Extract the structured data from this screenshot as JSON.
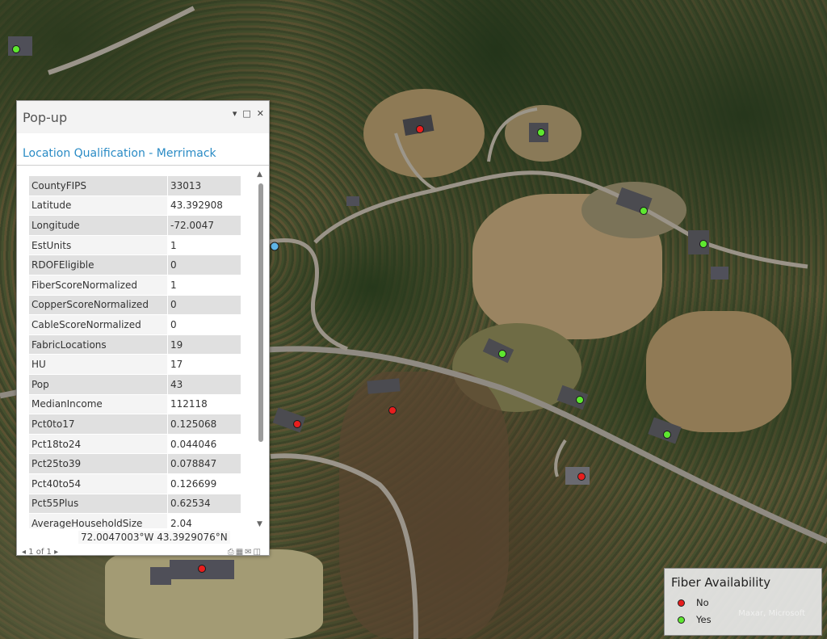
{
  "popup": {
    "title": "Pop-up",
    "controls": [
      "▾",
      "□",
      "✕"
    ],
    "layer_title": "Location Qualification - Merrimack",
    "rows": [
      {
        "key": "CountyFIPS",
        "value": "33013"
      },
      {
        "key": "Latitude",
        "value": "43.392908"
      },
      {
        "key": "Longitude",
        "value": "-72.0047"
      },
      {
        "key": "EstUnits",
        "value": "1"
      },
      {
        "key": "RDOFEligible",
        "value": "0"
      },
      {
        "key": "FiberScoreNormalized",
        "value": "1"
      },
      {
        "key": "CopperScoreNormalized",
        "value": "0"
      },
      {
        "key": "CableScoreNormalized",
        "value": "0"
      },
      {
        "key": "FabricLocations",
        "value": "19"
      },
      {
        "key": "HU",
        "value": "17"
      },
      {
        "key": "Pop",
        "value": "43"
      },
      {
        "key": "MedianIncome",
        "value": "112118"
      },
      {
        "key": "Pct0to17",
        "value": "0.125068"
      },
      {
        "key": "Pct18to24",
        "value": "0.044046"
      },
      {
        "key": "Pct25to39",
        "value": "0.078847"
      },
      {
        "key": "Pct40to54",
        "value": "0.126699"
      },
      {
        "key": "Pct55Plus",
        "value": "0.62534"
      },
      {
        "key": "AverageHouseholdSize",
        "value": "2.04"
      }
    ],
    "coordinates": "72.0047003°W 43.3929076°N",
    "pager": "1 of 1"
  },
  "legend": {
    "title": "Fiber Availability",
    "items": [
      {
        "label": "No",
        "color": "#e81e1e"
      },
      {
        "label": "Yes",
        "color": "#5ee830"
      }
    ],
    "watermark": "Maxar, Microsoft"
  },
  "markers": {
    "yes_color": "#5ee830",
    "no_color": "#e81e1e",
    "selected_color": "#5fb4e6"
  }
}
